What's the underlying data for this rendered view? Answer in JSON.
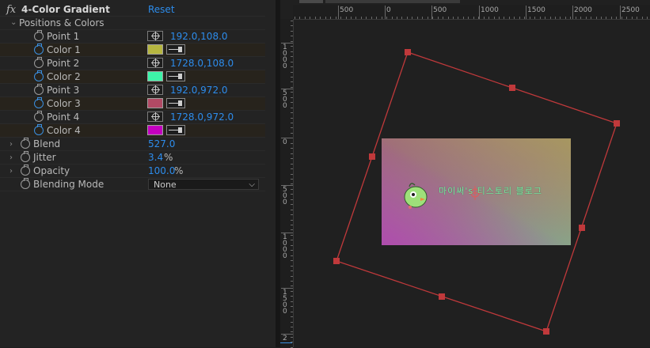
{
  "effect": {
    "fx_label": "fx",
    "name": "4-Color Gradient",
    "reset_label": "Reset",
    "group_label": "Positions & Colors",
    "points": [
      {
        "label": "Point 1",
        "value": "192.0,108.0"
      },
      {
        "label": "Point 2",
        "value": "1728.0,108.0"
      },
      {
        "label": "Point 3",
        "value": "192.0,972.0"
      },
      {
        "label": "Point 4",
        "value": "1728.0,972.0"
      }
    ],
    "colors": [
      {
        "label": "Color 1",
        "swatch": "#b6b640"
      },
      {
        "label": "Color 2",
        "swatch": "#3ef4a8"
      },
      {
        "label": "Color 3",
        "swatch": "#b24a64"
      },
      {
        "label": "Color 4",
        "swatch": "#c400c0"
      }
    ],
    "blend": {
      "label": "Blend",
      "value": "527.0"
    },
    "jitter": {
      "label": "Jitter",
      "value": "3.4",
      "unit": "%"
    },
    "opacity": {
      "label": "Opacity",
      "value": "100.0",
      "unit": "%"
    },
    "blending_mode": {
      "label": "Blending Mode",
      "value": "None"
    }
  },
  "viewer": {
    "hruler_labels": [
      "500",
      "0",
      "500",
      "1000",
      "1500",
      "2000",
      "2500"
    ],
    "vruler_labels": [
      "1000",
      "500",
      "0",
      "500",
      "1000",
      "1500",
      "2"
    ],
    "watermark_text": "마이써's 티스토리 블로그",
    "colors": {
      "outline": "#c0393b",
      "handle": "#c0393b",
      "c1": "#b6a064",
      "c2": "#9a8e86",
      "c3": "#b050ac",
      "c4": "#7ea888"
    }
  }
}
